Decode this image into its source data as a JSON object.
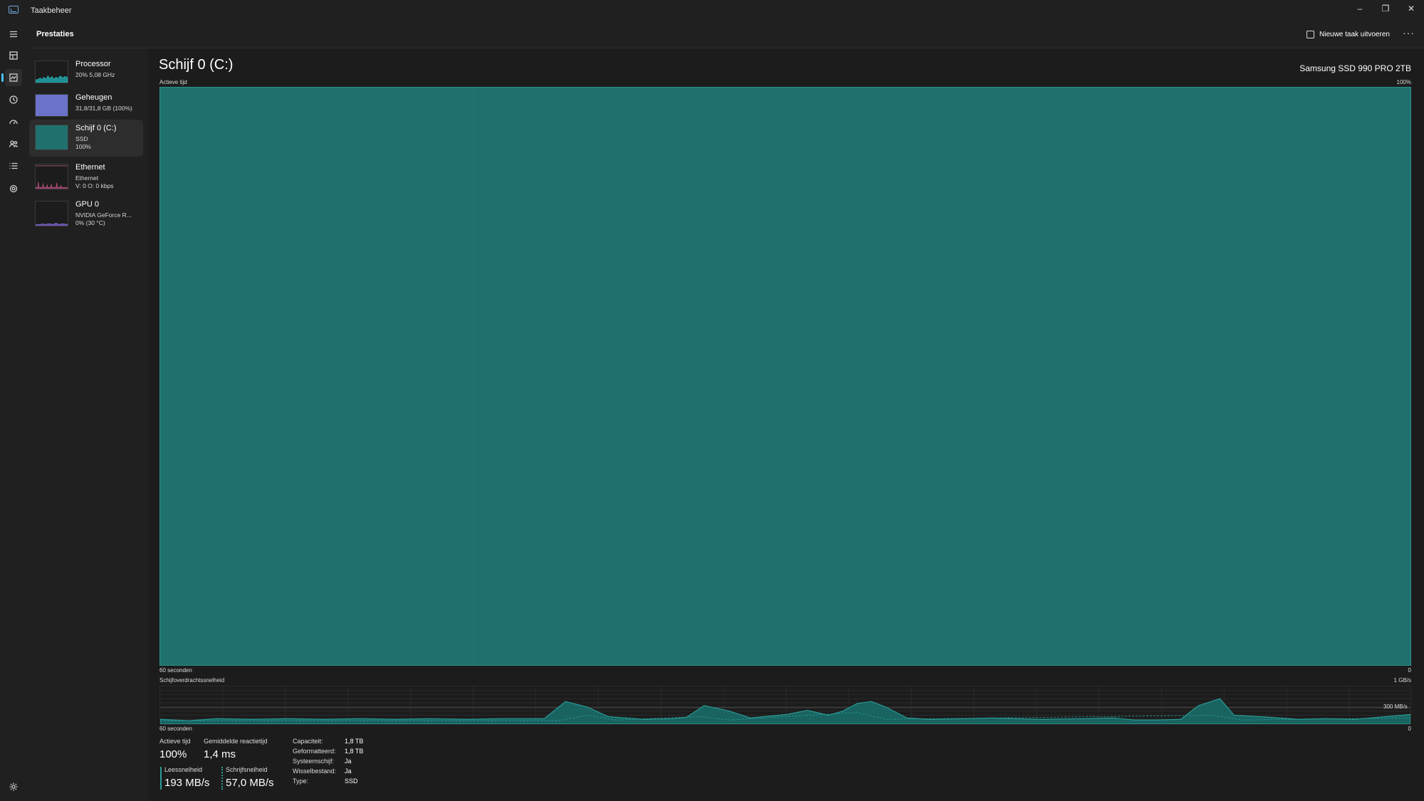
{
  "window": {
    "title": "Taakbeheer",
    "minimize": "–",
    "restore": "❐",
    "close": "✕"
  },
  "header": {
    "page_title": "Prestaties",
    "new_task_label": "Nieuwe taak uitvoeren",
    "more_label": "···"
  },
  "nav_rail": {
    "items": [
      "menu-icon",
      "processes-icon",
      "performance-icon",
      "app-history-icon",
      "startup-icon",
      "users-icon",
      "details-icon",
      "services-icon",
      "settings-icon"
    ],
    "active": "performance-icon"
  },
  "sidebar": {
    "items": [
      {
        "name": "Processor",
        "lines": [
          "20%  5,08 GHz"
        ],
        "color": "#2bb3b7"
      },
      {
        "name": "Geheugen",
        "lines": [
          "31,8/31,8 GB (100%)"
        ],
        "color": "#7b84d8"
      },
      {
        "name": "Schijf 0 (C:)",
        "lines": [
          "SSD",
          "100%"
        ],
        "color": "#2a8a85"
      },
      {
        "name": "Ethernet",
        "lines": [
          "Ethernet",
          "V: 0 O: 0 kbps"
        ],
        "color": "#c85a8a"
      },
      {
        "name": "GPU 0",
        "lines": [
          "NVIDIA GeForce R...",
          "0% (30 °C)"
        ],
        "color": "#8a6cd8"
      }
    ],
    "selected_index": 2
  },
  "main": {
    "title": "Schijf 0 (C:)",
    "device": "Samsung SSD 990 PRO 2TB",
    "active_time_graph": {
      "label": "Actieve tijd",
      "max_label": "100%",
      "x_left": "60 seconden",
      "x_right": "0",
      "value_percent": 100
    },
    "transfer_graph": {
      "label": "Schijfoverdrachtssnelheid",
      "max_label": "1 GB/s",
      "mid_label": "300 MB/s",
      "x_left": "60 seconden",
      "x_right": "0"
    },
    "stats": {
      "active_time_label": "Actieve tijd",
      "active_time_value": "100%",
      "response_label": "Gemiddelde reactietijd",
      "response_value": "1,4 ms",
      "read_label": "Leessnelheid",
      "read_value": "193 MB/s",
      "write_label": "Schrijfsnelheid",
      "write_value": "57,0 MB/s"
    },
    "info": [
      {
        "label": "Capaciteit:",
        "value": "1,8 TB"
      },
      {
        "label": "Geformatteerd:",
        "value": "1,8 TB"
      },
      {
        "label": "Systeemschijf:",
        "value": "Ja"
      },
      {
        "label": "Wisselbestand:",
        "value": "Ja"
      },
      {
        "label": "Type:",
        "value": "SSD"
      }
    ]
  },
  "colors": {
    "accent": "#4cc2ff",
    "disk_fill": "#20716e",
    "disk_line": "#2c8f8a"
  }
}
